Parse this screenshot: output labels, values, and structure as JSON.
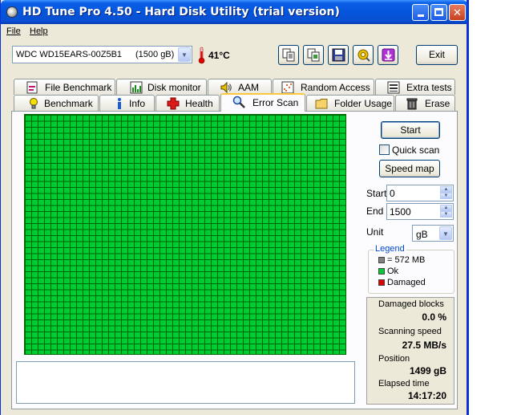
{
  "window": {
    "title": "HD Tune Pro 4.50 - Hard Disk Utility (trial version)"
  },
  "menu": {
    "file": "File",
    "help": "Help"
  },
  "toolbar": {
    "drive_name": "WDC WD15EARS-00Z5B1",
    "drive_capacity": "(1500 gB)",
    "temperature": "41°C",
    "exit_label": "Exit",
    "icons": [
      "copy-text-icon",
      "copy-image-icon",
      "save-icon",
      "options-icon",
      "download-icon"
    ]
  },
  "tabs_top": [
    {
      "label": "File Benchmark",
      "icon": "file-benchmark-icon"
    },
    {
      "label": "Disk monitor",
      "icon": "disk-monitor-icon"
    },
    {
      "label": "AAM",
      "icon": "speaker-icon"
    },
    {
      "label": "Random Access",
      "icon": "random-access-icon"
    },
    {
      "label": "Extra tests",
      "icon": "extra-tests-icon"
    }
  ],
  "tabs_bottom": [
    {
      "label": "Benchmark",
      "icon": "lightbulb-icon"
    },
    {
      "label": "Info",
      "icon": "info-icon"
    },
    {
      "label": "Health",
      "icon": "health-cross-icon"
    },
    {
      "label": "Error Scan",
      "icon": "magnifier-icon",
      "active": true
    },
    {
      "label": "Folder Usage",
      "icon": "folder-icon"
    },
    {
      "label": "Erase",
      "icon": "trash-icon"
    }
  ],
  "scan": {
    "start_button": "Start",
    "quick_scan_label": "Quick scan",
    "quick_scan_checked": false,
    "speed_map_button": "Speed map",
    "start_label": "Start",
    "start_value": "0",
    "end_label": "End",
    "end_value": "1500",
    "unit_label": "Unit",
    "unit_value": "gB"
  },
  "legend": {
    "title": "Legend",
    "items": [
      {
        "label": "= 572 MB",
        "color": "#808080"
      },
      {
        "label": "Ok",
        "color": "#00cc33"
      },
      {
        "label": "Damaged",
        "color": "#e00000"
      }
    ]
  },
  "stats": {
    "damaged_label": "Damaged blocks",
    "damaged_value": "0.0 %",
    "speed_label": "Scanning speed",
    "speed_value": "27.5 MB/s",
    "position_label": "Position",
    "position_value": "1499 gB",
    "elapsed_label": "Elapsed time",
    "elapsed_value": "14:17:20"
  },
  "colors": {
    "block_ok": "#00cc33",
    "block_grid": "#006600",
    "accent": "#0046d5"
  }
}
